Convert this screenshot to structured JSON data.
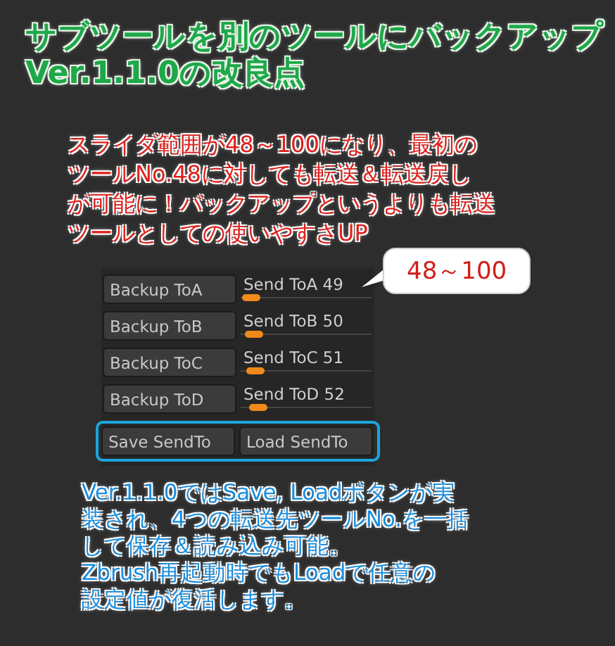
{
  "title": {
    "lines": [
      "サブツールを別のツールにバックアップ",
      "Ver.1.1.0の改良点"
    ]
  },
  "note_top": [
    "スライダ範囲が48～100になり、最初の",
    "ツールNo.48に対しても転送＆転送戻し",
    "が可能に！バックアップというよりも転送",
    "ツールとしての使いやすさUP"
  ],
  "callout": "48～100",
  "rows": [
    {
      "button": "Backup ToA",
      "slider_label": "Send ToA",
      "value": "49",
      "level": 0.02
    },
    {
      "button": "Backup ToB",
      "slider_label": "Send ToB",
      "value": "50",
      "level": 0.04
    },
    {
      "button": "Backup ToC",
      "slider_label": "Send ToC",
      "value": "51",
      "level": 0.06
    },
    {
      "button": "Backup ToD",
      "slider_label": "Send ToD",
      "value": "52",
      "level": 0.08
    }
  ],
  "bottom_buttons": [
    "Save SendTo",
    "Load SendTo"
  ],
  "note_bottom": [
    "Ver.1.1.0ではSave, Loadボタンが実",
    "装され、4つの転送先ツールNo.を一括",
    "して保存＆読み込み可能。",
    "Zbrush再起動時でもLoadで任意の",
    "設定値が復活します。"
  ]
}
